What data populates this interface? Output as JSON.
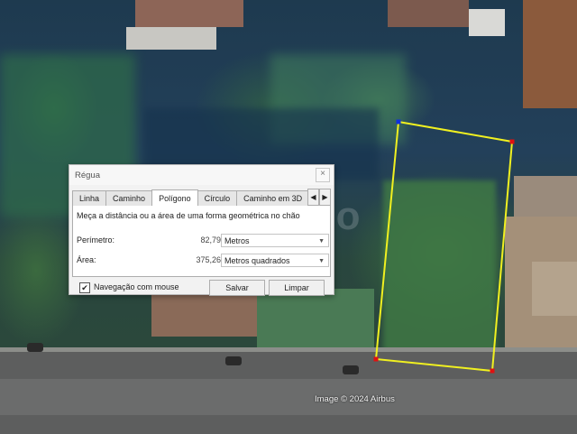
{
  "dialog": {
    "title": "Régua",
    "close_label": "×",
    "tabs": [
      "Linha",
      "Caminho",
      "Polígono",
      "Círculo",
      "Caminho em 3D"
    ],
    "active_tab": "Polígono",
    "tab_prev": "◀",
    "tab_next": "▶",
    "description": "Meça a distância ou a área de uma forma geométrica no chão",
    "perimeter": {
      "label": "Perímetro:",
      "value": "82,79",
      "unit": "Metros"
    },
    "area": {
      "label": "Área:",
      "value": "375,26",
      "unit": "Metros quadrados"
    },
    "mouse_nav": {
      "label": "Navegação com mouse",
      "checked": true,
      "check_mark": "✔"
    },
    "save_label": "Salvar",
    "clear_label": "Limpar"
  },
  "map": {
    "credit": "Image © 2024 Airbus",
    "watermark": "...o",
    "polygon_color": "#f0f020",
    "vertex_color": "#e01010",
    "active_vertex_color": "#1030e0"
  }
}
